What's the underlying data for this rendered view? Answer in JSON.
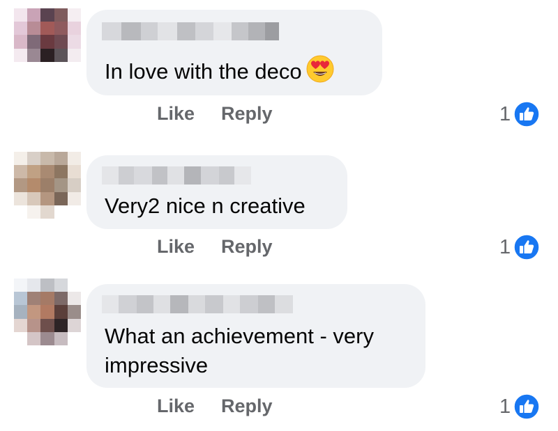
{
  "comments": [
    {
      "text": "In love with the deco",
      "emoji": "heart-eyes-emoji",
      "actions": {
        "like": "Like",
        "reply": "Reply"
      },
      "reaction_count": "1"
    },
    {
      "text": "Very2 nice n creative",
      "actions": {
        "like": "Like",
        "reply": "Reply"
      },
      "reaction_count": "1"
    },
    {
      "text_lines": [
        "What an achievement - very",
        "impressive"
      ],
      "actions": {
        "like": "Like",
        "reply": "Reply"
      },
      "reaction_count": "1"
    }
  ],
  "colors": {
    "bubble": "#f0f2f5",
    "action_text": "#65676b",
    "like_badge": "#1877f2"
  },
  "icons": [
    "thumbs-up-icon",
    "heart-eyes-emoji"
  ]
}
